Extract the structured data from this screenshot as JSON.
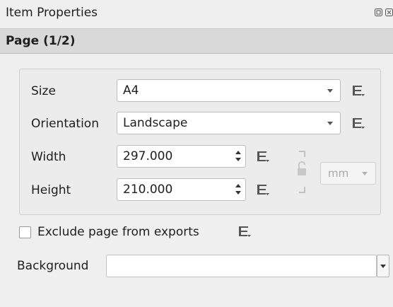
{
  "panel": {
    "title": "Item Properties",
    "controls": [
      "float-button",
      "close-button"
    ]
  },
  "section": {
    "title": "Page (1/2)"
  },
  "page_size": {
    "size_label": "Size",
    "size_value": "A4",
    "orientation_label": "Orientation",
    "orientation_value": "Landscape",
    "width_label": "Width",
    "width_value": "297.000",
    "height_label": "Height",
    "height_value": "210.000",
    "units_value": "mm",
    "units_enabled": false
  },
  "exclude": {
    "label": "Exclude page from exports",
    "checked": false
  },
  "background": {
    "label": "Background",
    "value": ""
  },
  "icons": {
    "data_defined": "data-defined-override-icon",
    "lock": "lock-aspect-ratio-icon"
  }
}
